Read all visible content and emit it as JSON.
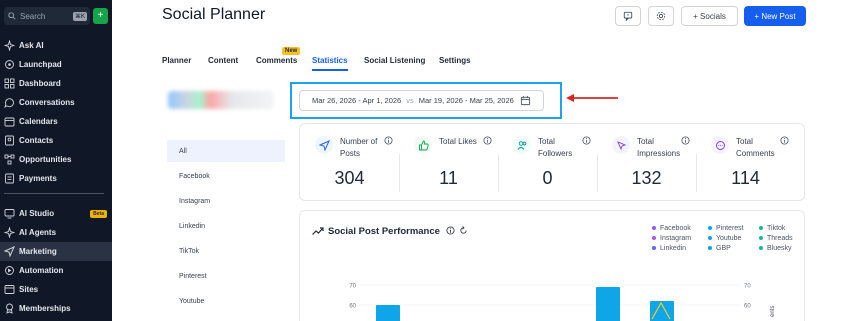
{
  "sidebar": {
    "search_placeholder": "Search",
    "search_kbd": "⌘K",
    "plus_label": "+",
    "items": [
      {
        "label": "Ask AI",
        "icon": "sparkle-icon"
      },
      {
        "label": "Launchpad",
        "icon": "rocket-icon"
      },
      {
        "label": "Dashboard",
        "icon": "grid-icon"
      },
      {
        "label": "Conversations",
        "icon": "chat-icon"
      },
      {
        "label": "Calendars",
        "icon": "calendar-icon"
      },
      {
        "label": "Contacts",
        "icon": "contacts-icon"
      },
      {
        "label": "Opportunities",
        "icon": "opportunities-icon"
      },
      {
        "label": "Payments",
        "icon": "payments-icon"
      },
      {
        "label": "AI Studio",
        "icon": "ai-studio-icon",
        "badge": "Beta"
      },
      {
        "label": "AI Agents",
        "icon": "ai-agents-icon"
      },
      {
        "label": "Marketing",
        "icon": "send-icon"
      },
      {
        "label": "Automation",
        "icon": "automation-icon"
      },
      {
        "label": "Sites",
        "icon": "sites-icon"
      },
      {
        "label": "Memberships",
        "icon": "memberships-icon"
      }
    ]
  },
  "header": {
    "title": "Social Planner",
    "socials_label": "+ Socials",
    "new_post_label": "+ New Post"
  },
  "tabs": {
    "items": [
      "Planner",
      "Content",
      "Comments",
      "Statistics",
      "Social Listening",
      "Settings"
    ],
    "active": "Statistics",
    "new_badge": "New"
  },
  "date_range": {
    "current": "Mar 26, 2026 - Apr 1, 2026",
    "vs": "vs",
    "compare": "Mar 19, 2026 - Mar 25, 2026"
  },
  "platforms": [
    "All",
    "Facebook",
    "Instagram",
    "Linkedin",
    "TikTok",
    "Pinterest",
    "Youtube"
  ],
  "stats": [
    {
      "label": "Number of Posts",
      "value": "304",
      "icon": "send-icon",
      "color": "#2563eb",
      "bg": "#eff6ff"
    },
    {
      "label": "Total Likes",
      "value": "11",
      "icon": "thumbs-up-icon",
      "color": "#16a34a",
      "bg": "#f0fdf4"
    },
    {
      "label": "Total Followers",
      "value": "0",
      "icon": "followers-icon",
      "color": "#0d9488",
      "bg": "#f0fdfa"
    },
    {
      "label": "Total Impressions",
      "value": "132",
      "icon": "cursor-icon",
      "color": "#7c3aed",
      "bg": "#f5f3ff"
    },
    {
      "label": "Total Comments",
      "value": "114",
      "icon": "comment-icon",
      "color": "#7c3aed",
      "bg": "#f5f3ff"
    }
  ],
  "performance": {
    "title": "Social Post Performance",
    "legend": [
      {
        "name": "Facebook",
        "color": "#8b5cf6"
      },
      {
        "name": "Instagram",
        "color": "#a855f7"
      },
      {
        "name": "Linkedin",
        "color": "#6366f1"
      },
      {
        "name": "Pinterest",
        "color": "#0ea5e9"
      },
      {
        "name": "Youtube",
        "color": "#0ea5e9"
      },
      {
        "name": "GBP",
        "color": "#0ea5e9"
      },
      {
        "name": "Tiktok",
        "color": "#14b8a6"
      },
      {
        "name": "Threads",
        "color": "#14b8a6"
      },
      {
        "name": "Bluesky",
        "color": "#14b8a6"
      }
    ],
    "y_ticks_left": [
      "70",
      "60"
    ],
    "y_ticks_right": [
      "70",
      "60"
    ],
    "right_axis_label": "ents"
  },
  "chart_data": {
    "type": "bar",
    "ylim": [
      0,
      70
    ],
    "bars": [
      {
        "series": "Facebook",
        "value": 60,
        "color": "#0ea5e9"
      },
      {
        "series": "Instagram",
        "value": 69,
        "color": "#0ea5e9"
      },
      {
        "series": "Linkedin",
        "value": 62,
        "color": "#0ea5e9"
      }
    ],
    "y_ticks": [
      70,
      60
    ]
  }
}
